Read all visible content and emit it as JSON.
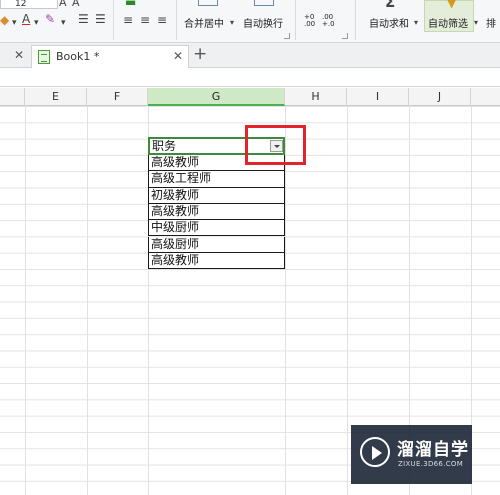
{
  "ribbon": {
    "font_size_value": "12",
    "merge_center_label": "合并居中",
    "wrap_text_label": "自动换行",
    "autosum_label": "自动求和",
    "autofilter_label": "自动筛选",
    "sort_label": "排",
    "decimal_increase_label": "+0\n.00",
    "decimal_decrease_label": ".00\n+.0"
  },
  "tabs": {
    "workbook_name": "Book1 *"
  },
  "columns": [
    "E",
    "F",
    "G",
    "H",
    "I",
    "J"
  ],
  "table": {
    "header": "职务",
    "rows": [
      "高级教师",
      "高级工程师",
      "初级教师",
      "高级教师",
      "中级厨师",
      "高级厨师",
      "高级教师"
    ]
  },
  "watermark": {
    "title": "溜溜自学",
    "subtitle": "ZIXUE.3D66.COM"
  },
  "colors": {
    "highlight": "#e0262a",
    "selection": "#3d8b36"
  }
}
